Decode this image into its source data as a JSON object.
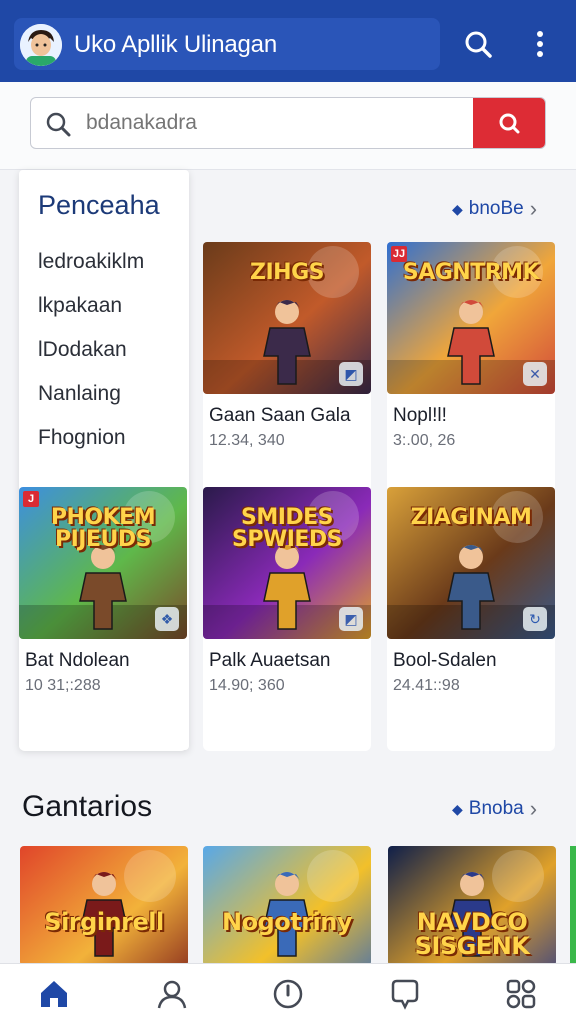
{
  "header": {
    "title": "Uko Apllik Ulinagan",
    "search_icon": "search-icon",
    "menu_icon": "more-vertical-icon"
  },
  "search": {
    "placeholder": "bdanakadra",
    "value": ""
  },
  "categories": {
    "title": "Penceaha",
    "items": [
      {
        "label": "ledroakiklm"
      },
      {
        "label": "lkpakaan"
      },
      {
        "label": "lDodakan"
      },
      {
        "label": "Nanlaing"
      },
      {
        "label": "Fhognion"
      }
    ]
  },
  "featured": {
    "see_more": "bnoBe",
    "games": [
      {
        "name": "Gaan Saan Gala",
        "count": "12.34, 340",
        "logo": "ZIHGS",
        "colors": [
          "#6a3b1a",
          "#c15a2a",
          "#3b2a4a"
        ],
        "badge": "◩",
        "tag": ""
      },
      {
        "name": "Nopl!l!",
        "count": "3:.00, 26",
        "logo": "SAGNTRMK",
        "colors": [
          "#2f6fd1",
          "#f0a63a",
          "#d14a3a"
        ],
        "badge": "✕",
        "tag": "JJ"
      },
      {
        "name": "Bat Ndolean",
        "count": "10 31;:288",
        "logo": "PHOKEM PIJEUDS",
        "colors": [
          "#3d8fe0",
          "#5fb84a",
          "#7a4a2a"
        ],
        "badge": "❖",
        "tag": "J"
      },
      {
        "name": "Palk Auaetsan",
        "count": "14.90; 360",
        "logo": "SMIDES SPWIEDS",
        "colors": [
          "#2a1a4a",
          "#8a2ab8",
          "#e0a12a"
        ],
        "badge": "◩",
        "tag": ""
      },
      {
        "name": "Bool-Sdalen",
        "count": "24.41::98",
        "logo": "ZIAGINAM",
        "colors": [
          "#d9a13a",
          "#6a3a1a",
          "#3a5a8a"
        ],
        "badge": "↻",
        "tag": ""
      }
    ]
  },
  "popular": {
    "title": "Gantarios",
    "see_more": "Bnoba",
    "games": [
      {
        "logo": "Sirginrell",
        "colors": [
          "#e0452a",
          "#f2b23a",
          "#7a1a1a"
        ]
      },
      {
        "logo": "Nogotriny",
        "colors": [
          "#58a8e8",
          "#f2c02a",
          "#3a6ab8"
        ]
      },
      {
        "logo": "NAVDCO SISGENK",
        "colors": [
          "#0f1f4a",
          "#e0a12a",
          "#2a3a8a"
        ]
      }
    ]
  },
  "bottom_nav": [
    {
      "icon": "home-icon",
      "active": true
    },
    {
      "icon": "profile-icon",
      "active": false
    },
    {
      "icon": "clock-icon",
      "active": false
    },
    {
      "icon": "chat-icon",
      "active": false
    },
    {
      "icon": "apps-grid-icon",
      "active": false
    }
  ],
  "colors": {
    "primary": "#1f48a6",
    "accent": "#dd2c35",
    "background": "#f3f4f7"
  }
}
